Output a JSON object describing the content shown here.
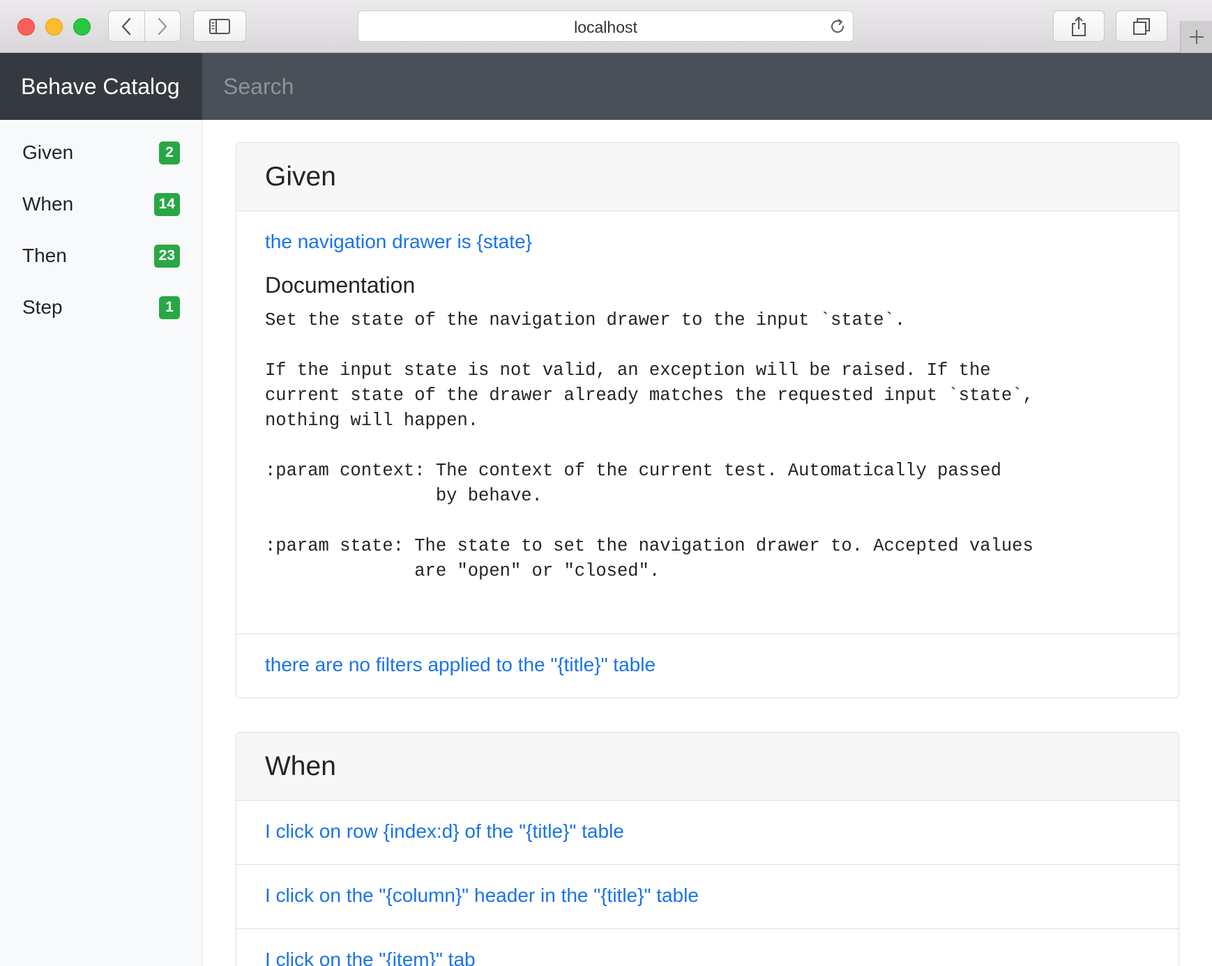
{
  "browser": {
    "url": "localhost"
  },
  "app": {
    "brand": "Behave Catalog",
    "search_placeholder": "Search"
  },
  "sidebar": {
    "items": [
      {
        "label": "Given",
        "count": "2"
      },
      {
        "label": "When",
        "count": "14"
      },
      {
        "label": "Then",
        "count": "23"
      },
      {
        "label": "Step",
        "count": "1"
      }
    ]
  },
  "sections": {
    "given": {
      "title": "Given",
      "steps": [
        {
          "text": "the navigation drawer is {state}",
          "doc_heading": "Documentation",
          "doc_body": "Set the state of the navigation drawer to the input `state`.\n\nIf the input state is not valid, an exception will be raised. If the\ncurrent state of the drawer already matches the requested input `state`,\nnothing will happen.\n\n:param context: The context of the current test. Automatically passed\n                by behave.\n\n:param state: The state to set the navigation drawer to. Accepted values\n              are \"open\" or \"closed\"."
        },
        {
          "text": "there are no filters applied to the \"{title}\" table"
        }
      ]
    },
    "when": {
      "title": "When",
      "steps": [
        {
          "text": "I click on row {index:d} of the \"{title}\" table"
        },
        {
          "text": "I click on the \"{column}\" header in the \"{title}\" table"
        },
        {
          "text": "I click on the \"{item}\" tab"
        }
      ]
    }
  },
  "colors": {
    "link": "#1a73e8",
    "badge": "#28a745",
    "brand_bg": "#343a40",
    "topbar_bg": "#495057",
    "sidebar_bg": "#f8f9fa"
  },
  "icons": [
    "back-chevron-icon",
    "forward-chevron-icon",
    "sidebar-toggle-icon",
    "reload-icon",
    "share-icon",
    "tabs-icon",
    "plus-icon"
  ]
}
